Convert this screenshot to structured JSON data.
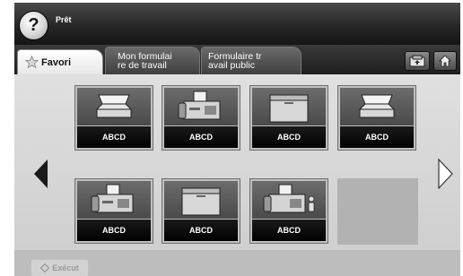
{
  "header": {
    "status_text": "Prêt",
    "help_glyph": "?"
  },
  "tabs": [
    {
      "label": "Favori",
      "icon": "star-icon",
      "active": true
    },
    {
      "label_line1": "Mon formulai",
      "label_line2": "re de travail",
      "active": false
    },
    {
      "label_line1": "Formulaire tr",
      "label_line2": "avail public",
      "active": false
    }
  ],
  "toolbar": {
    "admin_icon": "job-status-icon",
    "home_icon": "home-icon"
  },
  "grid": {
    "items": [
      {
        "label": "ABCD",
        "icon": "scanner-icon"
      },
      {
        "label": "ABCD",
        "icon": "fax-icon"
      },
      {
        "label": "ABCD",
        "icon": "folder-box-icon"
      },
      {
        "label": "ABCD",
        "icon": "scanner-icon"
      },
      {
        "label": "ABCD",
        "icon": "fax-icon"
      },
      {
        "label": "ABCD",
        "icon": "folder-box-icon"
      },
      {
        "label": "ABCD",
        "icon": "fax-user-icon"
      }
    ]
  },
  "footer": {
    "execute_label": "Exécut"
  }
}
